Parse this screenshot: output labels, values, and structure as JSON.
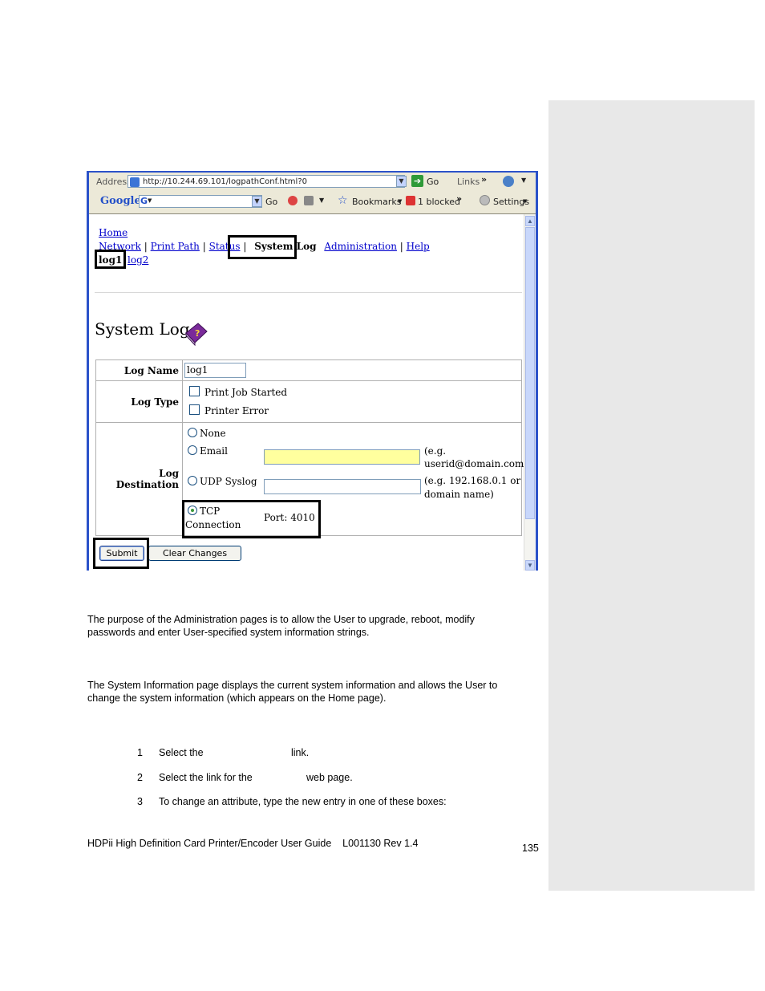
{
  "browser": {
    "address_label": "Address",
    "url": "http://10.244.69.101/logpathConf.html?0",
    "go_label": "Go",
    "links_label": "Links",
    "chevrons": "»",
    "google_logo": "Google",
    "google_go": "Go",
    "bookmarks_label": "Bookmarks",
    "blocked_label": "1 blocked",
    "settings_label": "Settings"
  },
  "nav": {
    "home": "Home",
    "network": "Network",
    "print_path": "Print Path",
    "status": "Status",
    "system_log": "System Log",
    "administration": "Administration",
    "help": "Help",
    "separator": "|",
    "log1": "log1",
    "log2": "log2"
  },
  "page_heading": "System Log",
  "form": {
    "log_name_label": "Log Name",
    "log_name_value": "log1",
    "log_type_label": "Log Type",
    "log_type_options": [
      "Print Job Started",
      "Printer Error"
    ],
    "log_destination_label": "Log Destination",
    "dest_none": "None",
    "dest_email": "Email",
    "dest_email_hint_1": "(e.g.",
    "dest_email_hint_2": "userid@domain.com)",
    "dest_udp": "UDP Syslog",
    "dest_udp_hint_1": "(e.g. 192.168.0.1 or",
    "dest_udp_hint_2": "domain name)",
    "dest_tcp_1": "TCP",
    "dest_tcp_2": "Connection",
    "tcp_port": "Port: 4010",
    "selected_destination": "TCP Connection",
    "submit_label": "Submit",
    "clear_label": "Clear Changes"
  },
  "doc": {
    "para1_line1": "The purpose of the Administration pages is to allow the User to upgrade, reboot, modify",
    "para1_line2": "passwords and enter User-specified system information strings.",
    "para2_line1": "The System Information page displays the current system information and allows the User to",
    "para2_line2": "change the system information (which appears on the Home page).",
    "steps": [
      {
        "num": "1",
        "text_a": "Select the",
        "text_b": "link."
      },
      {
        "num": "2",
        "text_a": "Select the link for the",
        "text_b": "web page."
      },
      {
        "num": "3",
        "text_a": "To change an attribute, type the new entry in one of these boxes:",
        "text_b": ""
      }
    ],
    "footer": "HDPii High Definition Card Printer/Encoder User Guide    L001130 Rev 1.4",
    "page_number": "135"
  }
}
